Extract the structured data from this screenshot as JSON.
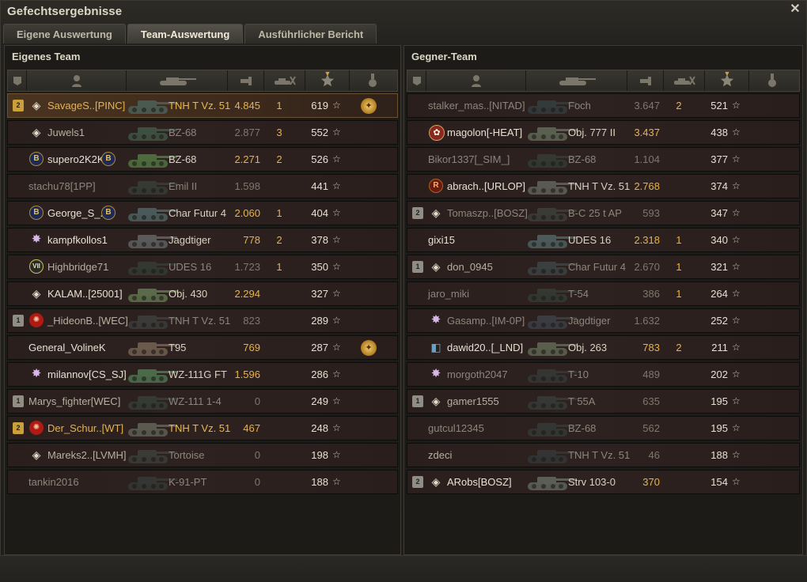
{
  "window": {
    "title": "Gefechtsergebnisse",
    "close_label": "✕"
  },
  "tabs": [
    {
      "label": "Eigene Auswertung",
      "active": false
    },
    {
      "label": "Team-Auswertung",
      "active": true
    },
    {
      "label": "Ausführlicher Bericht",
      "active": false
    }
  ],
  "columns": {
    "icons": [
      "platoon-icon",
      "player-icon",
      "tank-icon",
      "damage-icon",
      "kills-icon",
      "xp-star-icon",
      "medal-icon"
    ],
    "sorted_column": "xp"
  },
  "own_team": {
    "title": "Eigenes Team",
    "players": [
      {
        "rank": "2",
        "rank_style": "gold",
        "badge": "diamond",
        "name": "SavageS..[PINC]",
        "name_style": "gold",
        "tank": "TNH T Vz. 51",
        "tank_style": "gold",
        "damage": "4.845",
        "damage_style": "",
        "kills": "1",
        "xp": "619",
        "medal": true,
        "highlight": true,
        "tank_color": "#4a5a52"
      },
      {
        "rank": "",
        "rank_style": "",
        "badge": "diamond",
        "name": "Juwels1",
        "name_style": "",
        "tank": "BZ-68",
        "tank_style": "dim",
        "damage": "2.877",
        "damage_style": "dim",
        "kills": "3",
        "xp": "552",
        "medal": false,
        "highlight": false,
        "tank_color": "#3d5040"
      },
      {
        "rank": "",
        "rank_style": "",
        "badge": "b",
        "name": "supero2K2K",
        "name_style": "white",
        "tank": "BZ-68",
        "tank_style": "",
        "damage": "2.271",
        "damage_style": "",
        "kills": "2",
        "xp": "526",
        "medal": false,
        "highlight": false,
        "tank_color": "#4d6a3c"
      },
      {
        "rank": "",
        "rank_style": "",
        "badge": "none",
        "name": "stachu78[1PP]",
        "name_style": "dim",
        "tank": "Emil II",
        "tank_style": "dim",
        "damage": "1.598",
        "damage_style": "dim",
        "kills": "",
        "xp": "441",
        "medal": false,
        "highlight": false,
        "tank_color": "#353a35"
      },
      {
        "rank": "",
        "rank_style": "",
        "badge": "b",
        "name": "George_S_..",
        "name_style": "white",
        "tank": "Char Futur 4",
        "tank_style": "",
        "damage": "2.060",
        "damage_style": "",
        "kills": "1",
        "xp": "404",
        "medal": false,
        "highlight": false,
        "tank_color": "#4a5a5a"
      },
      {
        "rank": "",
        "rank_style": "",
        "badge": "star",
        "name": "kampfkollos1",
        "name_style": "white",
        "tank": "Jagdtiger",
        "tank_style": "",
        "damage": "778",
        "damage_style": "",
        "kills": "2",
        "xp": "378",
        "medal": false,
        "highlight": false,
        "tank_color": "#5a5a5a"
      },
      {
        "rank": "",
        "rank_style": "",
        "badge": "vii",
        "name": "Highbridge71",
        "name_style": "",
        "tank": "UDES 16",
        "tank_style": "dim",
        "damage": "1.723",
        "damage_style": "dim",
        "kills": "1",
        "xp": "350",
        "medal": false,
        "highlight": false,
        "tank_color": "#333833"
      },
      {
        "rank": "",
        "rank_style": "",
        "badge": "diamond",
        "name": "KALAM..[25001]",
        "name_style": "white",
        "tank": "Obj. 430",
        "tank_style": "",
        "damage": "2.294",
        "damage_style": "",
        "kills": "",
        "xp": "327",
        "medal": false,
        "highlight": false,
        "tank_color": "#5a6a4a"
      },
      {
        "rank": "1",
        "rank_style": "",
        "badge": "red",
        "name": "_HideonB..[WEC]",
        "name_style": "",
        "tank": "TNH T Vz. 51",
        "tank_style": "dim",
        "damage": "823",
        "damage_style": "dim",
        "kills": "",
        "xp": "289",
        "medal": false,
        "highlight": false,
        "tank_color": "#3a3a38"
      },
      {
        "rank": "",
        "rank_style": "",
        "badge": "none",
        "name": "General_VolineK",
        "name_style": "white",
        "tank": "T95",
        "tank_style": "",
        "damage": "769",
        "damage_style": "",
        "kills": "",
        "xp": "287",
        "medal": true,
        "highlight": false,
        "tank_color": "#6a5a4a"
      },
      {
        "rank": "",
        "rank_style": "",
        "badge": "star",
        "name": "milannov[CS_SJ]",
        "name_style": "white",
        "tank": "WZ-111G FT",
        "tank_style": "",
        "damage": "1.596",
        "damage_style": "",
        "kills": "",
        "xp": "286",
        "medal": false,
        "highlight": false,
        "tank_color": "#4a6a4a"
      },
      {
        "rank": "1",
        "rank_style": "",
        "badge": "none",
        "name": "Marys_fighter[WEC]",
        "name_style": "",
        "tank": "WZ-111 1-4",
        "tank_style": "dim",
        "damage": "0",
        "damage_style": "dim",
        "kills": "",
        "xp": "249",
        "medal": false,
        "highlight": false,
        "tank_color": "#343a34"
      },
      {
        "rank": "2",
        "rank_style": "gold",
        "badge": "red",
        "name": "Der_Schur..[WT]",
        "name_style": "gold",
        "tank": "TNH T Vz. 51",
        "tank_style": "gold",
        "damage": "467",
        "damage_style": "",
        "kills": "",
        "xp": "248",
        "medal": false,
        "highlight": false,
        "tank_color": "#5a5a50"
      },
      {
        "rank": "",
        "rank_style": "",
        "badge": "diamond",
        "name": "Mareks2..[LVMH]",
        "name_style": "",
        "tank": "Tortoise",
        "tank_style": "dim",
        "damage": "0",
        "damage_style": "dim",
        "kills": "",
        "xp": "198",
        "medal": false,
        "highlight": false,
        "tank_color": "#3a3a36"
      },
      {
        "rank": "",
        "rank_style": "",
        "badge": "none",
        "name": "tankin2016",
        "name_style": "dim",
        "tank": "K-91-PT",
        "tank_style": "dim",
        "damage": "0",
        "damage_style": "dim",
        "kills": "",
        "xp": "188",
        "medal": false,
        "highlight": false,
        "tank_color": "#333633"
      }
    ]
  },
  "enemy_team": {
    "title": "Gegner-Team",
    "players": [
      {
        "rank": "",
        "rank_style": "",
        "badge": "none",
        "name": "stalker_mas..[NITAD]",
        "name_style": "dim",
        "tank": "Foch",
        "tank_style": "dim",
        "damage": "3.647",
        "damage_style": "dim",
        "kills": "2",
        "xp": "521",
        "medal": false,
        "highlight": false,
        "tank_color": "#333a3a"
      },
      {
        "rank": "",
        "rank_style": "",
        "badge": "flower",
        "name": "magolon[-HEAT]",
        "name_style": "white",
        "tank": "Obj. 777 II",
        "tank_style": "",
        "damage": "3.437",
        "damage_style": "",
        "kills": "",
        "xp": "438",
        "medal": false,
        "highlight": false,
        "tank_color": "#5a6050"
      },
      {
        "rank": "",
        "rank_style": "",
        "badge": "none",
        "name": "Bikor1337[_SIM_]",
        "name_style": "dim",
        "tank": "BZ-68",
        "tank_style": "dim",
        "damage": "1.104",
        "damage_style": "dim",
        "kills": "",
        "xp": "377",
        "medal": false,
        "highlight": false,
        "tank_color": "#333833"
      },
      {
        "rank": "",
        "rank_style": "",
        "badge": "r",
        "name": "abrach..[URLOP]",
        "name_style": "white",
        "tank": "TNH T Vz. 51",
        "tank_style": "",
        "damage": "2.768",
        "damage_style": "",
        "kills": "",
        "xp": "374",
        "medal": false,
        "highlight": false,
        "tank_color": "#5a5a54"
      },
      {
        "rank": "2",
        "rank_style": "",
        "badge": "diamond",
        "name": "Tomaszp..[BOSZ]",
        "name_style": "dim",
        "tank": "B-C 25 t AP",
        "tank_style": "dim",
        "damage": "593",
        "damage_style": "dim",
        "kills": "",
        "xp": "347",
        "medal": false,
        "highlight": false,
        "tank_color": "#3a3a36"
      },
      {
        "rank": "",
        "rank_style": "",
        "badge": "none",
        "name": "gixi15",
        "name_style": "white",
        "tank": "UDES 16",
        "tank_style": "",
        "damage": "2.318",
        "damage_style": "",
        "kills": "1",
        "xp": "340",
        "medal": false,
        "highlight": false,
        "tank_color": "#4a5a58"
      },
      {
        "rank": "1",
        "rank_style": "",
        "badge": "diamond",
        "name": "don_0945",
        "name_style": "",
        "tank": "Char Futur 4",
        "tank_style": "dim",
        "damage": "2.670",
        "damage_style": "dim",
        "kills": "1",
        "xp": "321",
        "medal": false,
        "highlight": false,
        "tank_color": "#3a3f3f"
      },
      {
        "rank": "",
        "rank_style": "",
        "badge": "none",
        "name": "jaro_miki",
        "name_style": "dim",
        "tank": "T-54",
        "tank_style": "dim",
        "damage": "386",
        "damage_style": "dim",
        "kills": "1",
        "xp": "264",
        "medal": false,
        "highlight": false,
        "tank_color": "#333833"
      },
      {
        "rank": "",
        "rank_style": "",
        "badge": "star",
        "name": "Gasamp..[IM-0P]",
        "name_style": "dim",
        "tank": "Jagdtiger",
        "tank_style": "dim",
        "damage": "1.632",
        "damage_style": "dim",
        "kills": "",
        "xp": "252",
        "medal": false,
        "highlight": false,
        "tank_color": "#3a3c42"
      },
      {
        "rank": "",
        "rank_style": "",
        "badge": "cube",
        "name": "dawid20..[_LND]",
        "name_style": "white",
        "tank": "Obj. 263",
        "tank_style": "",
        "damage": "783",
        "damage_style": "",
        "kills": "2",
        "xp": "211",
        "medal": false,
        "highlight": false,
        "tank_color": "#5a5e4c"
      },
      {
        "rank": "",
        "rank_style": "",
        "badge": "star",
        "name": "morgoth2047",
        "name_style": "dim",
        "tank": "T-10",
        "tank_style": "dim",
        "damage": "489",
        "damage_style": "dim",
        "kills": "",
        "xp": "202",
        "medal": false,
        "highlight": false,
        "tank_color": "#343634"
      },
      {
        "rank": "1",
        "rank_style": "",
        "badge": "diamond",
        "name": "gamer1555",
        "name_style": "",
        "tank": "T 55A",
        "tank_style": "dim",
        "damage": "635",
        "damage_style": "dim",
        "kills": "",
        "xp": "195",
        "medal": false,
        "highlight": false,
        "tank_color": "#353835"
      },
      {
        "rank": "",
        "rank_style": "",
        "badge": "none",
        "name": "gutcul12345",
        "name_style": "dim",
        "tank": "BZ-68",
        "tank_style": "dim",
        "damage": "562",
        "damage_style": "dim",
        "kills": "",
        "xp": "195",
        "medal": false,
        "highlight": false,
        "tank_color": "#333733"
      },
      {
        "rank": "",
        "rank_style": "",
        "badge": "none",
        "name": "zdeci",
        "name_style": "",
        "tank": "TNH T Vz. 51",
        "tank_style": "dim",
        "damage": "46",
        "damage_style": "dim",
        "kills": "",
        "xp": "188",
        "medal": false,
        "highlight": false,
        "tank_color": "#343434"
      },
      {
        "rank": "2",
        "rank_style": "",
        "badge": "diamond",
        "name": "ARobs[BOSZ]",
        "name_style": "white",
        "tank": "Strv 103-0",
        "tank_style": "",
        "damage": "370",
        "damage_style": "",
        "kills": "",
        "xp": "154",
        "medal": false,
        "highlight": false,
        "tank_color": "#5a5e54"
      }
    ]
  }
}
